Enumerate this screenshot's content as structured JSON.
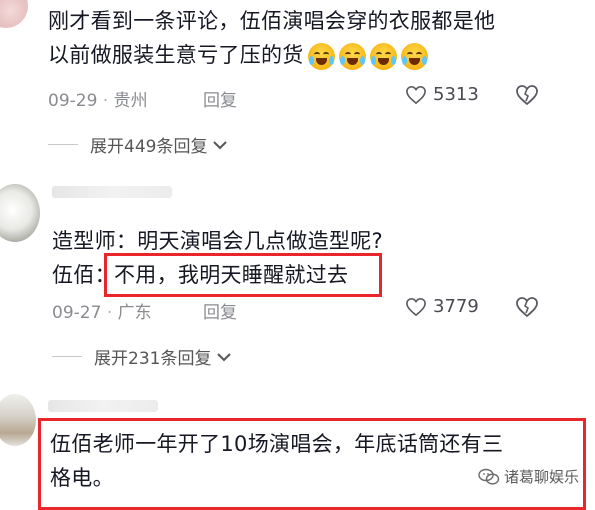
{
  "comments": [
    {
      "line1": "刚才看到一条评论，伍佰演唱会穿的衣服都是他",
      "line2": "以前做服装生意亏了压的货",
      "date": "09-29",
      "location": "贵州",
      "reply_label": "回复",
      "likes": "5313",
      "expand_label": "展开449条回复"
    },
    {
      "line1": "造型师：明天演唱会几点做造型呢?",
      "line2_prefix": "伍佰：",
      "line2_highlight": "不用，我明天睡醒就过去",
      "date": "09-27",
      "location": "广东",
      "reply_label": "回复",
      "likes": "3779",
      "expand_label": "展开231条回复"
    },
    {
      "line1": "伍佰老师一年开了10场演唱会，年底话筒还有三",
      "line2": "格电。"
    }
  ],
  "watermark": {
    "text": "诸葛聊娱乐",
    "icon": "wechat-icon"
  },
  "colors": {
    "highlight_border": "#e8262b",
    "meta_text": "#8a8b91"
  }
}
